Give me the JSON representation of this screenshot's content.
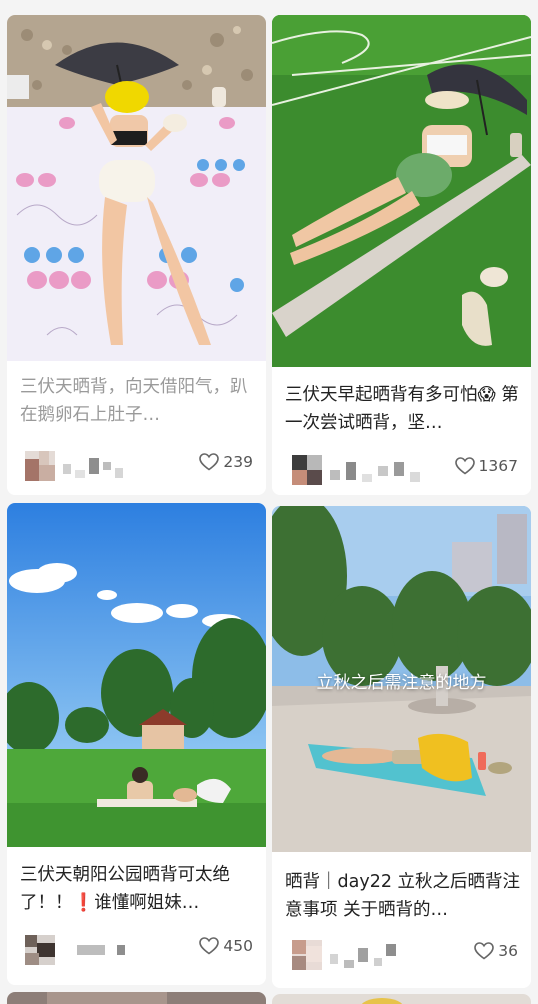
{
  "feed": {
    "cards": [
      {
        "title": "三伏天晒背，向天借阳气，趴在鹅卵石上肚子…",
        "likes": "239"
      },
      {
        "title": "三伏天早起晒背有多可怕😱 第一次尝试晒背，坚…",
        "likes": "1367"
      },
      {
        "title": "三伏天朝阳公园晒背可太绝了！！❗谁懂啊姐妹…",
        "likes": "450"
      },
      {
        "title": "晒背｜day22 立秋之后晒背注意事项 关于晒背的…",
        "likes": "36",
        "overlay": "立秋之后需注意的地方"
      }
    ]
  },
  "icons": {
    "like": "heart-outline-icon"
  },
  "colors": {
    "card_bg": "#ffffff",
    "page_bg": "#f4f4f4",
    "title_text": "#222222",
    "faded_title": "#9a9a9a"
  }
}
